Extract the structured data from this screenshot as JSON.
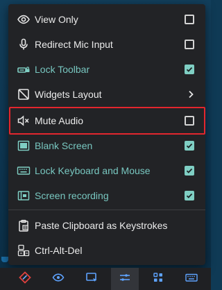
{
  "menu": {
    "items": [
      {
        "label": "View Only",
        "icon": "eye-icon",
        "control": "checkbox",
        "checked": false
      },
      {
        "label": "Redirect Mic Input",
        "icon": "microphone-icon",
        "control": "checkbox",
        "checked": false
      },
      {
        "label": "Lock Toolbar",
        "icon": "lock-toolbar-icon",
        "control": "checkbox",
        "checked": true
      },
      {
        "label": "Widgets Layout",
        "icon": "widgets-layout-icon",
        "control": "submenu"
      },
      {
        "label": "Mute Audio",
        "icon": "speaker-mute-icon",
        "control": "checkbox",
        "checked": false
      },
      {
        "label": "Blank Screen",
        "icon": "blank-screen-icon",
        "control": "checkbox",
        "checked": true
      },
      {
        "label": "Lock Keyboard and Mouse",
        "icon": "keyboard-icon",
        "control": "checkbox",
        "checked": true
      },
      {
        "label": "Screen recording",
        "icon": "screen-record-icon",
        "control": "checkbox",
        "checked": true
      },
      {
        "label": "Paste Clipboard as Keystrokes",
        "icon": "clipboard-icon",
        "control": "none"
      },
      {
        "label": "Ctrl-Alt-Del",
        "icon": "ctrl-alt-del-icon",
        "control": "none"
      }
    ],
    "highlighted_item": "Mute Audio"
  },
  "toolbar": {
    "buttons": [
      "move-icon",
      "eye-icon",
      "screen-cursor-icon",
      "sliders-icon",
      "grid-icon",
      "keyboard-icon"
    ],
    "active": "sliders-icon"
  },
  "colors": {
    "menu_background": "#222326",
    "text": "#ececec",
    "accent_teal": "#7fcfc4",
    "highlight_border": "#e3262e",
    "move_icon_red": "#e0413f"
  }
}
